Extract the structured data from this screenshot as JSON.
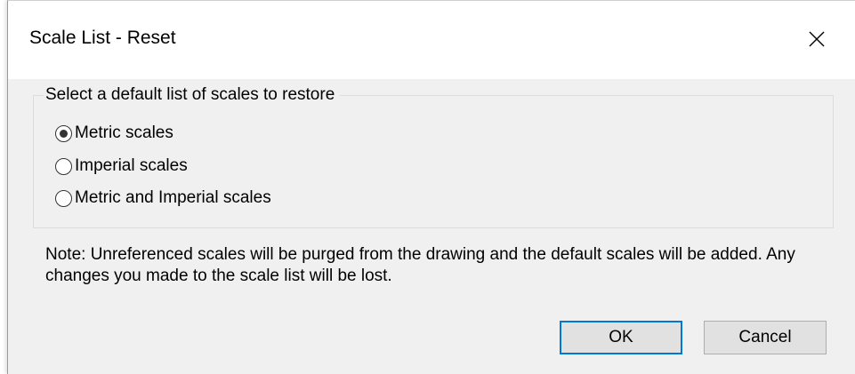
{
  "window": {
    "title": "Scale List - Reset",
    "close_icon": "close-icon"
  },
  "group": {
    "legend": "Select a default list of scales to restore",
    "options": [
      {
        "label": "Metric scales",
        "selected": true
      },
      {
        "label": "Imperial scales",
        "selected": false
      },
      {
        "label": "Metric and Imperial scales",
        "selected": false
      }
    ]
  },
  "note": "Note: Unreferenced scales will be purged from the drawing and the default scales will be added. Any changes you made to the scale list will be lost.",
  "buttons": {
    "ok_label": "OK",
    "cancel_label": "Cancel"
  },
  "colors": {
    "dialog_bg": "#f0f0f0",
    "titlebar_bg": "#ffffff",
    "focus_accent": "#0078d7",
    "button_bg": "#e1e1e1"
  }
}
